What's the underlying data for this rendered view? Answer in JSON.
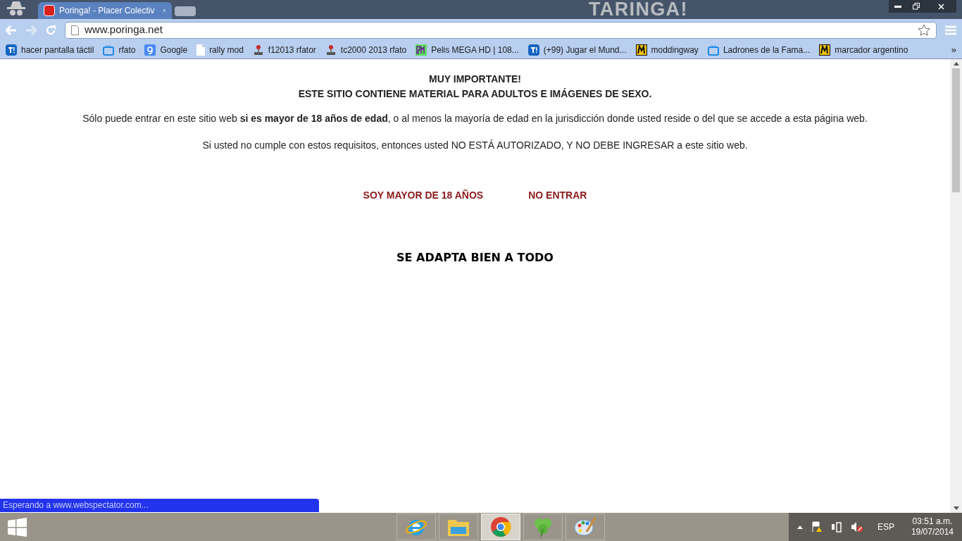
{
  "browser": {
    "tab_title": "Poringa! - Placer Colectiv",
    "theme_text": "TARINGA!",
    "url": "www.poringa.net"
  },
  "bookmarks": [
    {
      "label": "hacer pantalla táctil",
      "kind": "t"
    },
    {
      "label": "rfato",
      "kind": "tv"
    },
    {
      "label": "Google",
      "kind": "g"
    },
    {
      "label": "rally mod",
      "kind": "page"
    },
    {
      "label": "f12013 rfator",
      "kind": "joystick"
    },
    {
      "label": "tc2000 2013 rfato",
      "kind": "joystick"
    },
    {
      "label": "Pelis MEGA HD | 108...",
      "kind": "pm"
    },
    {
      "label": "(+99) Jugar el Mund...",
      "kind": "t"
    },
    {
      "label": "moddingway",
      "kind": "m"
    },
    {
      "label": "Ladrones de la Fama...",
      "kind": "tv"
    },
    {
      "label": "marcador argentino",
      "kind": "m"
    }
  ],
  "overflow": "»",
  "page": {
    "heading_1": "MUY IMPORTANTE!",
    "heading_2": "ESTE SITIO CONTIENE MATERIAL PARA ADULTOS E IMÁGENES DE SEXO.",
    "paragraph_1": "Sólo puede entrar en este sitio web **si es mayor de 18 años de edad**, o al menos la mayoría de edad en la jurisdicción donde usted reside o del que se accede a esta página web.",
    "paragraph_2": "Si usted no cumple con estos requisitos, entonces usted NO ESTÁ AUTORIZADO, Y NO DEBE INGRESAR a este sitio web.",
    "links": [
      "SOY MAYOR DE 18 AÑOS",
      "NO ENTRAR"
    ],
    "tagline": "SE ADAPTA BIEN A TODO"
  },
  "status": "Esperando a www.webspectator.com...",
  "taskbar": {
    "apps": [
      {
        "kind": "ie",
        "selected": false
      },
      {
        "kind": "folder",
        "selected": false
      },
      {
        "kind": "chrome",
        "selected": true
      },
      {
        "kind": "clover",
        "selected": false
      },
      {
        "kind": "paint",
        "selected": false
      }
    ],
    "language": "ESP",
    "time": "03:51 a.m.",
    "date": "19/07/2014"
  }
}
